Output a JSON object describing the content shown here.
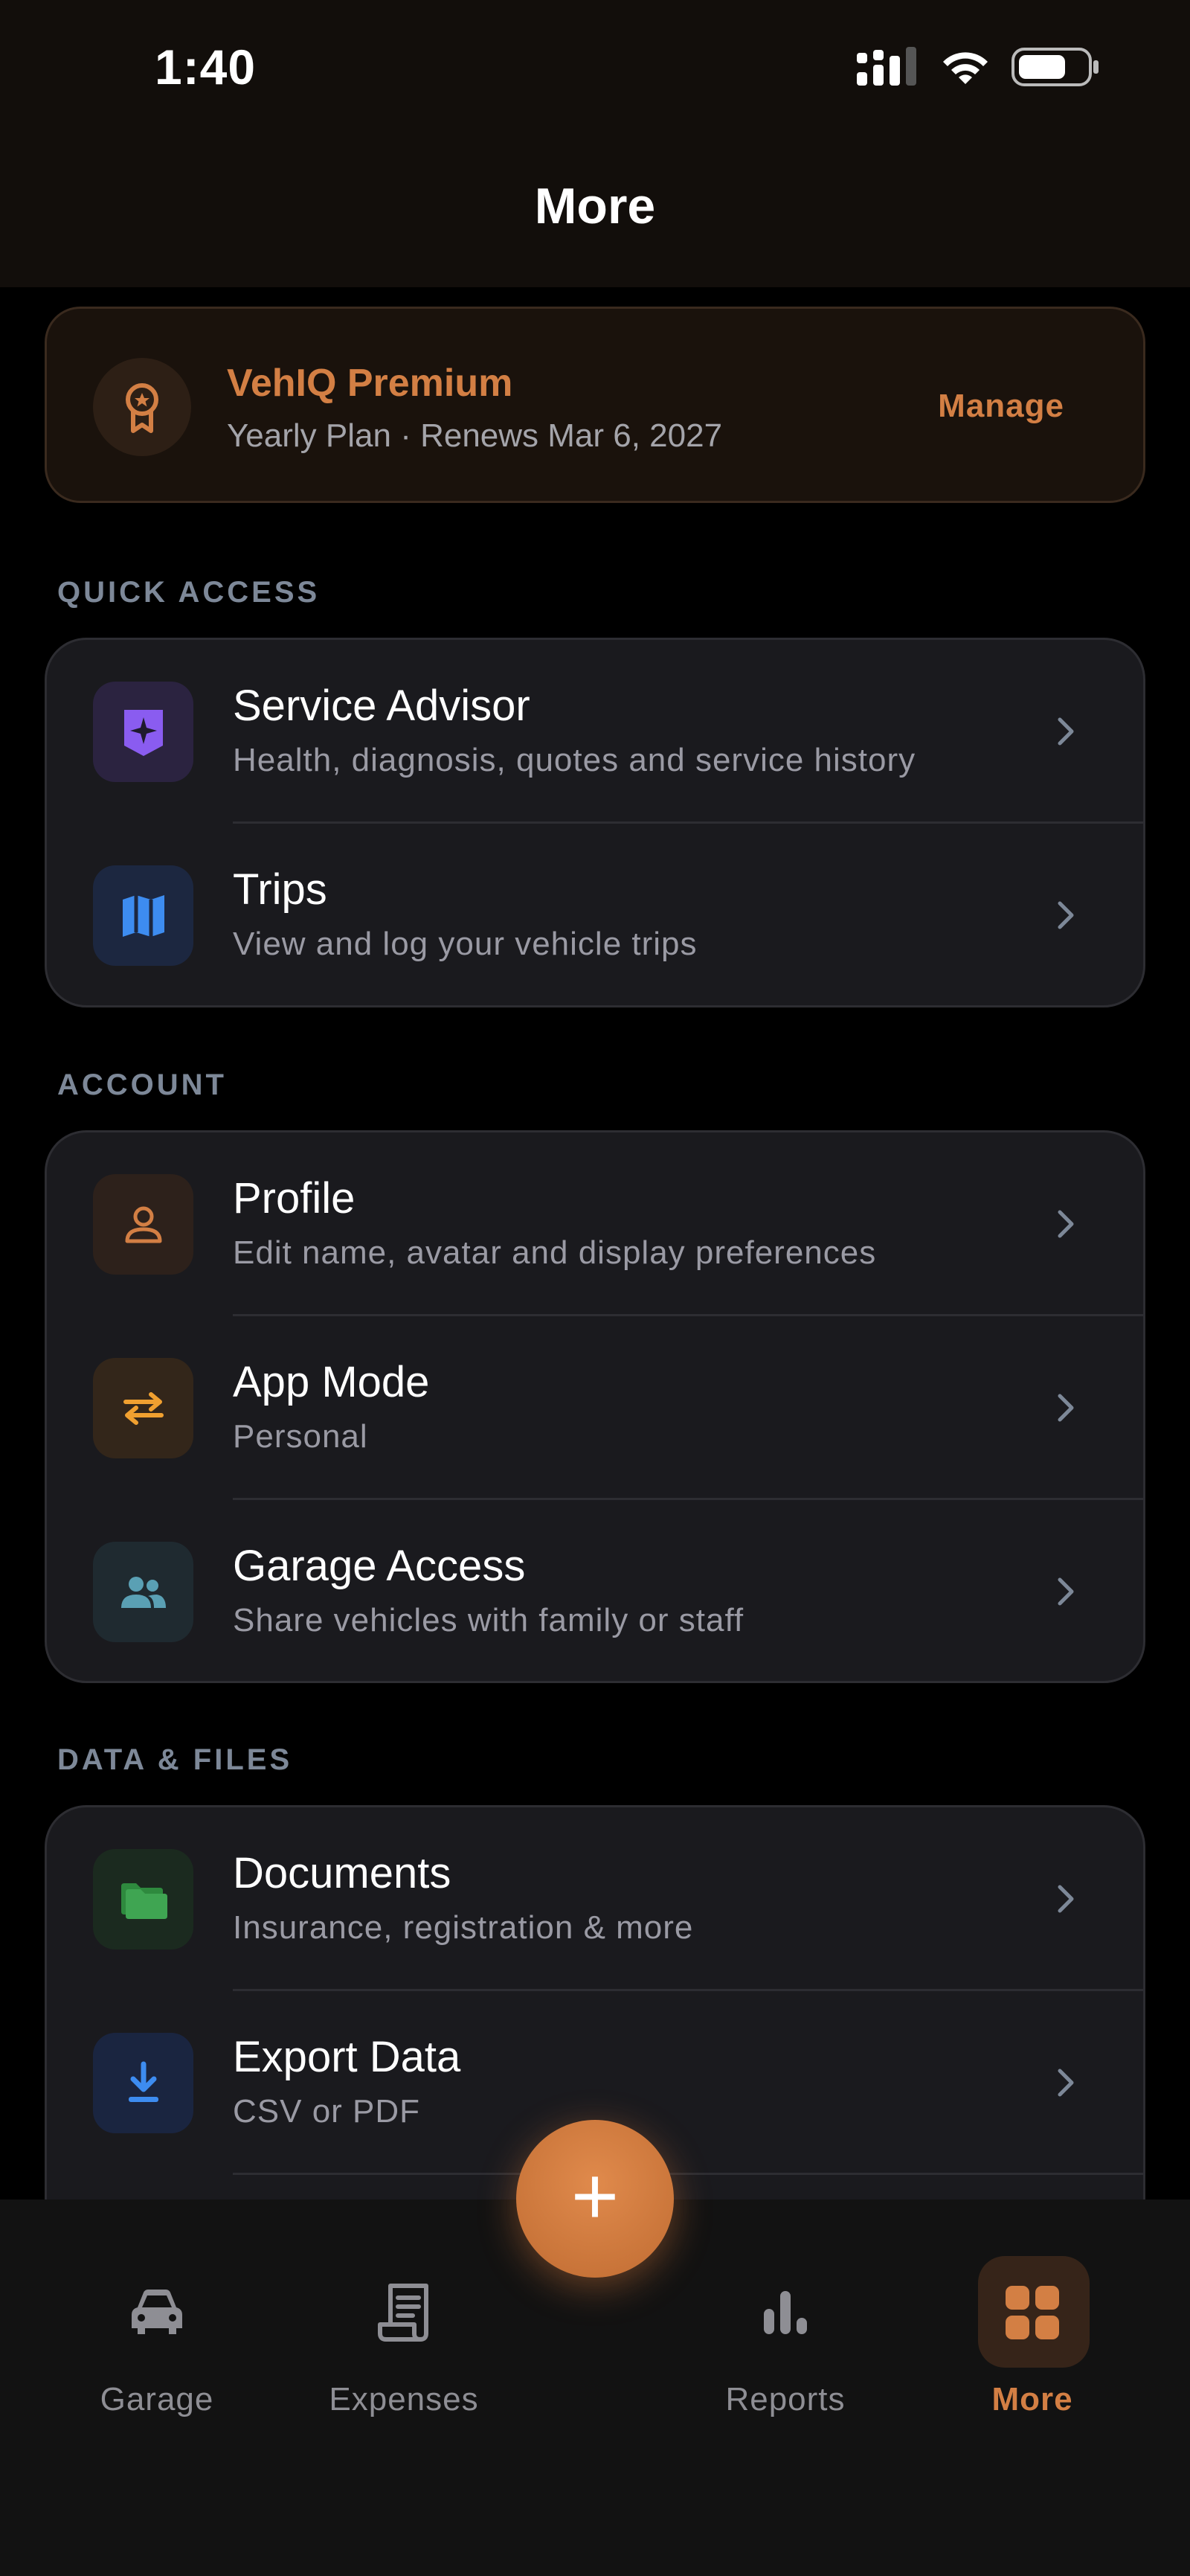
{
  "status_bar": {
    "time": "1:40"
  },
  "header": {
    "title": "More"
  },
  "premium": {
    "title": "VehIQ Premium",
    "subtitle": "Yearly Plan · Renews Mar 6, 2027",
    "manage_label": "Manage"
  },
  "sections": {
    "quick_access": {
      "label": "QUICK ACCESS",
      "items": [
        {
          "title": "Service Advisor",
          "subtitle": "Health, diagnosis, quotes and service history",
          "icon": "sparkle-icon"
        },
        {
          "title": "Trips",
          "subtitle": "View and log your vehicle trips",
          "icon": "map-icon"
        }
      ]
    },
    "account": {
      "label": "ACCOUNT",
      "items": [
        {
          "title": "Profile",
          "subtitle": "Edit name, avatar and display preferences",
          "icon": "person-icon"
        },
        {
          "title": "App Mode",
          "subtitle": "Personal",
          "icon": "swap-arrows-icon"
        },
        {
          "title": "Garage Access",
          "subtitle": "Share vehicles with family or staff",
          "icon": "people-icon"
        }
      ]
    },
    "data_files": {
      "label": "DATA & FILES",
      "items": [
        {
          "title": "Documents",
          "subtitle": "Insurance, registration & more",
          "icon": "folder-icon"
        },
        {
          "title": "Export Data",
          "subtitle": "CSV or PDF",
          "icon": "download-icon"
        }
      ]
    }
  },
  "tab_bar": {
    "tabs": [
      {
        "label": "Garage",
        "icon": "car-icon"
      },
      {
        "label": "Expenses",
        "icon": "receipt-icon"
      },
      {
        "label": "Reports",
        "icon": "bar-chart-icon"
      },
      {
        "label": "More",
        "icon": "grid-icon",
        "active": true
      }
    ],
    "fab_icon": "plus-icon",
    "fab_symbol": "+"
  },
  "colors": {
    "accent": "#d37f44",
    "background": "#000000",
    "card": "#1a1a1e",
    "header": "#120e0b"
  }
}
